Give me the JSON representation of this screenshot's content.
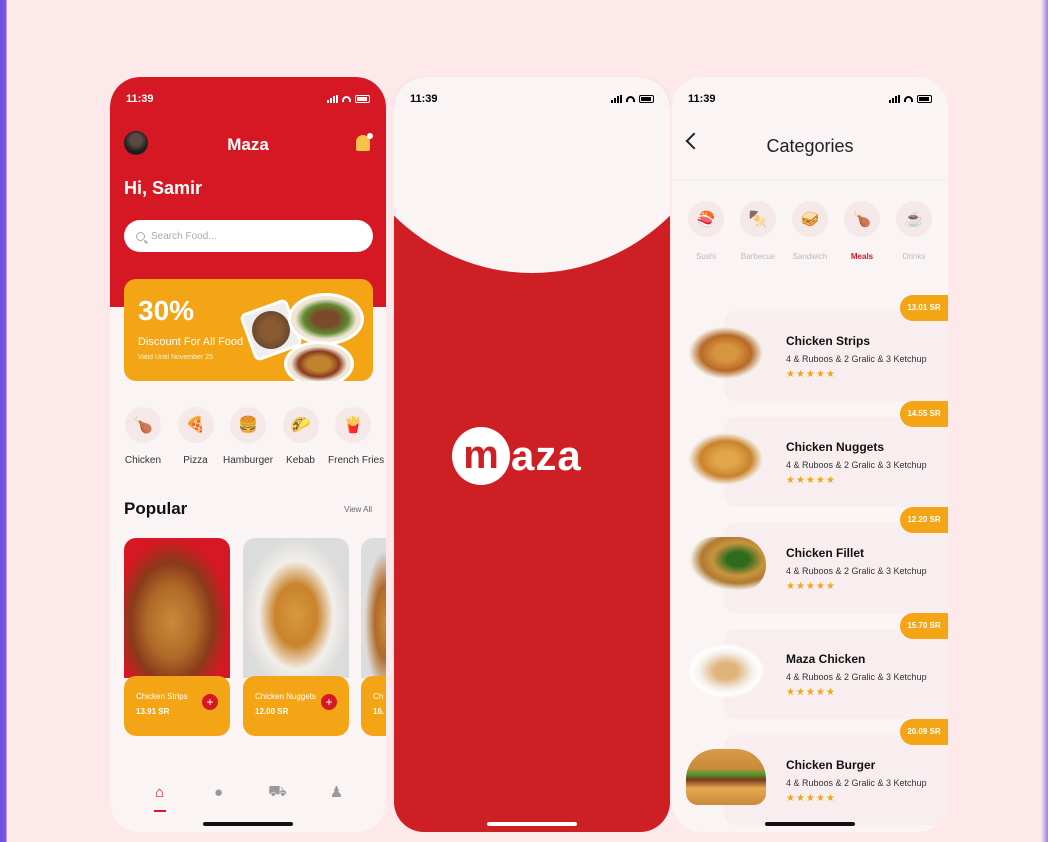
{
  "colors": {
    "brand_red": "#d51823",
    "accent_orange": "#f3a516",
    "background": "#fde9ea"
  },
  "phone1": {
    "time": "11:39",
    "app_title": "Maza",
    "greeting": "Hi, Samir",
    "search": {
      "placeholder": "Search Food..."
    },
    "promo": {
      "percent": "30%",
      "subtitle": "Discount For All Food",
      "valid": "Valid Until November 25"
    },
    "categories": [
      {
        "label": "Chicken",
        "icon": "drumstick-icon"
      },
      {
        "label": "Pizza",
        "icon": "pizza-icon"
      },
      {
        "label": "Hamburger",
        "icon": "burger-icon"
      },
      {
        "label": "Kebab",
        "icon": "taco-icon"
      },
      {
        "label": "French Fries",
        "icon": "fries-icon"
      }
    ],
    "popular_title": "Popular",
    "view_all": "View All",
    "popular": [
      {
        "name": "Chicken Strips",
        "price": "13.91 SR"
      },
      {
        "name": "Chicken Nuggets",
        "price": "12.00 SR"
      },
      {
        "name": "Ch",
        "price": "16."
      }
    ],
    "tabs": [
      "home-icon",
      "chat-icon",
      "cart-icon",
      "profile-icon"
    ]
  },
  "phone2": {
    "time": "11:39",
    "logo_first": "m",
    "logo_rest": "aza"
  },
  "phone3": {
    "time": "11:39",
    "title": "Categories",
    "categories": [
      {
        "label": "Sushi",
        "icon": "sushi-icon"
      },
      {
        "label": "Barbecue",
        "icon": "skewer-icon"
      },
      {
        "label": "Sandwich",
        "icon": "sandwich-icon"
      },
      {
        "label": "Meals",
        "icon": "drumstick-icon",
        "active": true
      },
      {
        "label": "Drinks",
        "icon": "cup-icon"
      }
    ],
    "products": [
      {
        "name": "Chicken Strips",
        "desc": "4 & Ruboos & 2 Gralic & 3 Ketchup",
        "price": "13.01 SR",
        "rating": "★★★★★"
      },
      {
        "name": "Chicken Nuggets",
        "desc": "4 & Ruboos & 2 Gralic & 3 Ketchup",
        "price": "14.55 SR",
        "rating": "★★★★★"
      },
      {
        "name": "Chicken Fillet",
        "desc": "4 & Ruboos & 2 Gralic & 3 Ketchup",
        "price": "12.20 SR",
        "rating": "★★★★★"
      },
      {
        "name": "Maza Chicken",
        "desc": "4 & Ruboos & 2 Gralic & 3 Ketchup",
        "price": "15.70 SR",
        "rating": "★★★★★"
      },
      {
        "name": "Chicken Burger",
        "desc": "4 & Ruboos & 2 Gralic & 3 Ketchup",
        "price": "20.09 SR",
        "rating": "★★★★★"
      }
    ]
  }
}
